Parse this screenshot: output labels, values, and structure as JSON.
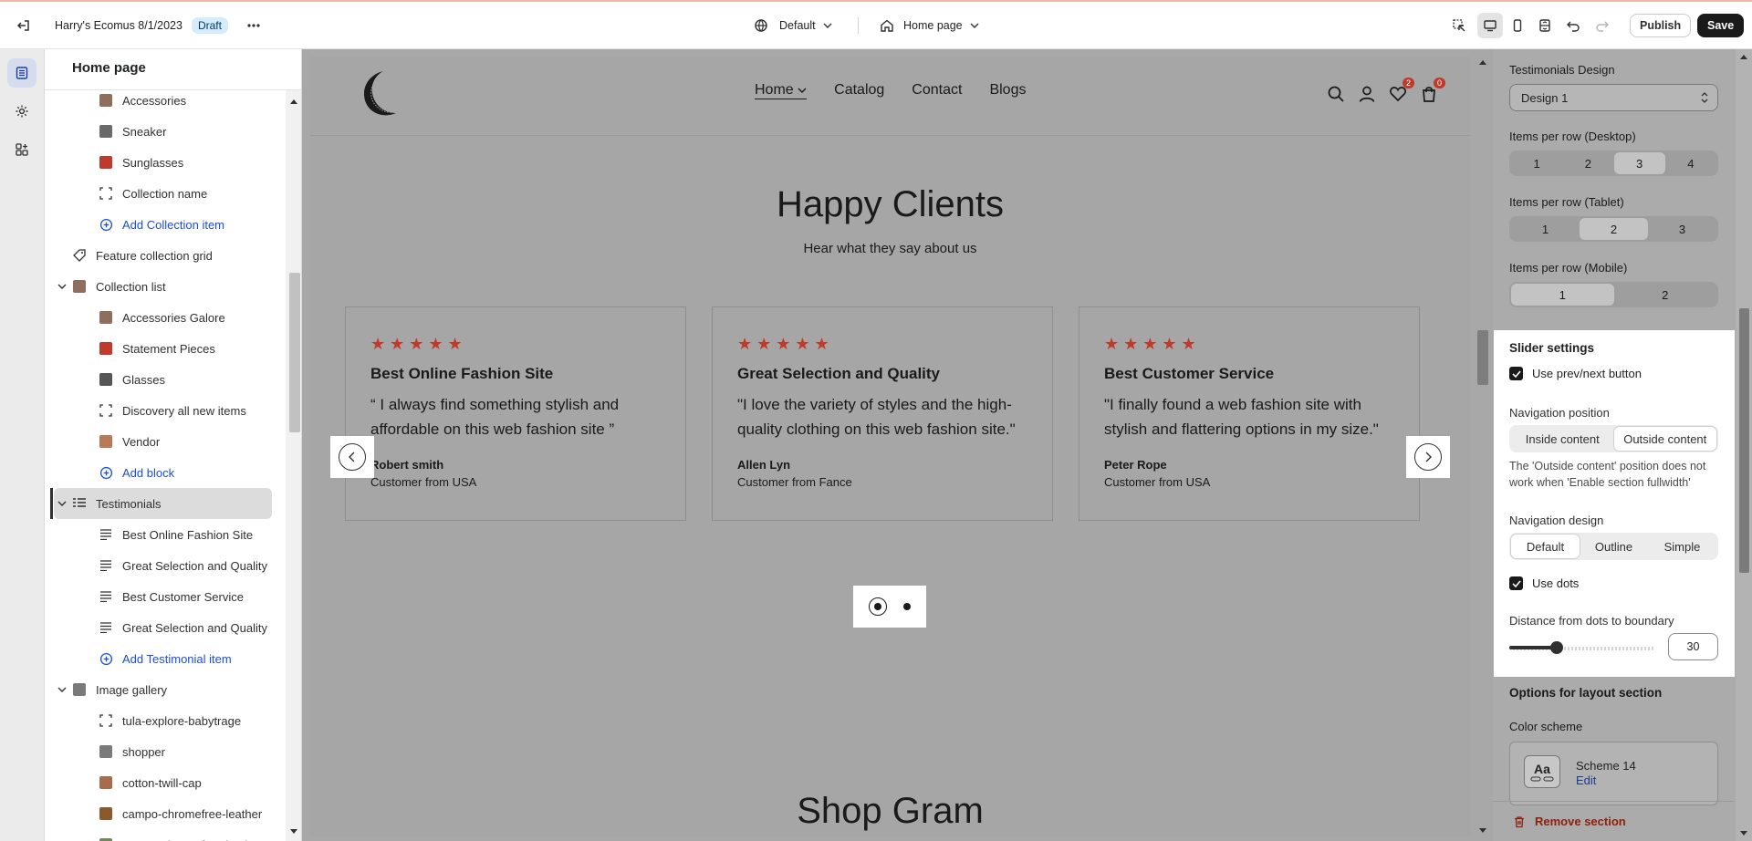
{
  "topbar": {
    "store_name": "Harry's Ecomus 8/1/2023",
    "status_badge": "Draft",
    "theme_selector": "Default",
    "page_selector": "Home page",
    "publish_label": "Publish",
    "save_label": "Save"
  },
  "left_panel": {
    "title": "Home page",
    "items": [
      {
        "label": "Accessories",
        "type": "child",
        "thumb": "#8e6e5c"
      },
      {
        "label": "Sneaker",
        "type": "child",
        "thumb": "#6a6a6a"
      },
      {
        "label": "Sunglasses",
        "type": "child",
        "thumb": "#c0392b"
      },
      {
        "label": "Collection name",
        "type": "child-frame"
      },
      {
        "label": "Add Collection item",
        "type": "add"
      },
      {
        "label": "Feature collection grid",
        "type": "parent-tag"
      },
      {
        "label": "Collection list",
        "type": "parent-open"
      },
      {
        "label": "Accessories Galore",
        "type": "child",
        "thumb": "#8e6e5c"
      },
      {
        "label": "Statement Pieces",
        "type": "child",
        "thumb": "#c0392b"
      },
      {
        "label": "Glasses",
        "type": "child",
        "thumb": "#555555"
      },
      {
        "label": "Discovery all new items",
        "type": "child-frame"
      },
      {
        "label": "Vendor",
        "type": "child",
        "thumb": "#b97a56"
      },
      {
        "label": "Add block",
        "type": "add"
      },
      {
        "label": "Testimonials",
        "type": "parent-selected"
      },
      {
        "label": "Best Online Fashion Site",
        "type": "child-lines"
      },
      {
        "label": "Great Selection and Quality",
        "type": "child-lines"
      },
      {
        "label": "Best Customer Service",
        "type": "child-lines"
      },
      {
        "label": "Great Selection and Quality",
        "type": "child-lines"
      },
      {
        "label": "Add Testimonial item",
        "type": "add"
      },
      {
        "label": "Image gallery",
        "type": "parent-open"
      },
      {
        "label": "tula-explore-babytrage",
        "type": "child-frame"
      },
      {
        "label": "shopper",
        "type": "child",
        "thumb": "#7a7a7a"
      },
      {
        "label": "cotton-twill-cap",
        "type": "child",
        "thumb": "#a86c4b"
      },
      {
        "label": "campo-chromefree-leather",
        "type": "child",
        "thumb": "#8a5a2b"
      },
      {
        "label": "campo-chromefree-leather",
        "type": "child",
        "thumb": "#6e8a5c"
      }
    ]
  },
  "store": {
    "nav": [
      "Home",
      "Catalog",
      "Contact",
      "Blogs"
    ],
    "wishlist_count": "2",
    "cart_count": "0",
    "section_title": "Happy Clients",
    "section_subtitle": "Hear what they say about us",
    "testimonials": [
      {
        "title": "Best Online Fashion Site",
        "text": "“ I always find something stylish and affordable on this web fashion site ”",
        "author": "Robert smith",
        "location": "Customer from USA"
      },
      {
        "title": "Great Selection and Quality",
        "text": "\"I love the variety of styles and the high-quality clothing on this web fashion site.\"",
        "author": "Allen Lyn",
        "location": "Customer from Fance"
      },
      {
        "title": "Best Customer Service",
        "text": "\"I finally found a web fashion site with stylish and flattering options in my size.\"",
        "author": "Peter Rope",
        "location": "Customer from USA"
      }
    ],
    "stars": "★★★★★",
    "next_section_title": "Shop Gram"
  },
  "right_panel": {
    "testimonials_design_label": "Testimonials Design",
    "testimonials_design_value": "Design 1",
    "desktop_label": "Items per row (Desktop)",
    "desktop_options": [
      "1",
      "2",
      "3",
      "4"
    ],
    "desktop_selected": 2,
    "tablet_label": "Items per row (Tablet)",
    "tablet_options": [
      "1",
      "2",
      "3"
    ],
    "tablet_selected": 1,
    "mobile_label": "Items per row (Mobile)",
    "mobile_options": [
      "1",
      "2"
    ],
    "mobile_selected": 0,
    "slider": {
      "title": "Slider settings",
      "use_prev_next": "Use prev/next button",
      "nav_position_label": "Navigation position",
      "nav_position_options": [
        "Inside content",
        "Outside content"
      ],
      "nav_position_selected": 1,
      "help_text": "The 'Outside content' position does not work when 'Enable section fullwidth'",
      "nav_design_label": "Navigation design",
      "nav_design_options": [
        "Default",
        "Outline",
        "Simple"
      ],
      "nav_design_selected": 0,
      "use_dots": "Use dots",
      "distance_label": "Distance from dots to boundary",
      "distance_value": "30"
    },
    "layout_options_title": "Options for layout section",
    "color_scheme_label": "Color scheme",
    "scheme_preview": "Aa",
    "scheme_name": "Scheme 14",
    "scheme_edit": "Edit",
    "remove_section": "Remove section"
  }
}
